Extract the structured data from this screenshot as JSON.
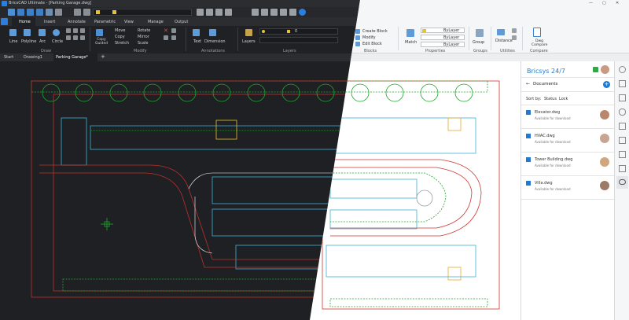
{
  "window": {
    "title": "BricsCAD Ultimate - [Parking Garage.dwg]"
  },
  "ribbon": {
    "tabs": [
      "Home",
      "Insert",
      "Annotate",
      "Parametric",
      "View",
      "Manage",
      "Output"
    ],
    "active_tab": "Home",
    "draw": {
      "panel": "Draw",
      "line": "Line",
      "polyline": "Polyline",
      "arc": "Arc",
      "circle": "Circle"
    },
    "modify": {
      "panel": "Modify",
      "copy_guided": "Copy Guided",
      "move": "Move",
      "copy": "Copy",
      "stretch": "Stretch",
      "rotate": "Rotate",
      "mirror": "Mirror",
      "scale": "Scale"
    },
    "annotations": {
      "panel": "Annotations",
      "text": "Text",
      "dimension": "Dimension"
    },
    "layers": {
      "panel": "Layers",
      "layers_button": "Layers",
      "current_layer": "0"
    },
    "blocks": {
      "panel": "Blocks",
      "create_block": "Create Block",
      "modify": "Modify",
      "edit_block": "Edit Block"
    },
    "properties": {
      "panel": "Properties",
      "match": "Match",
      "bylayer1": "ByLayer",
      "bylayer2": "ByLayer",
      "bylayer3": "ByLayer"
    },
    "groups": {
      "panel": "Groups",
      "group": "Group"
    },
    "utilities": {
      "panel": "Utilities",
      "distance": "Distance"
    },
    "compare": {
      "panel": "Compare",
      "dwg_compare": "Dwg Compare"
    }
  },
  "doc_tabs": [
    "Start",
    "Drawing1",
    "Parking Garage*"
  ],
  "doc_tab_add": "+",
  "side_panel": {
    "title": "Bricsys 24/7",
    "section": "Documents",
    "sort_label": "Sort by:",
    "sort_status": "Status",
    "sort_lock": "Lock",
    "files": [
      {
        "name": "Elevator.dwg",
        "status": "Available for download"
      },
      {
        "name": "HVAC.dwg",
        "status": "Available for download"
      },
      {
        "name": "Tower Building.dwg",
        "status": "Available for download"
      },
      {
        "name": "Villa.dwg",
        "status": "Available for download"
      }
    ]
  },
  "colors": {
    "accent": "#1f7ad6",
    "dark_bg": "#1e2024",
    "light_bg": "#ffffff",
    "cad_green": "#1fa72c",
    "cad_red": "#d0342c",
    "cad_cyan": "#3bb3d6"
  }
}
